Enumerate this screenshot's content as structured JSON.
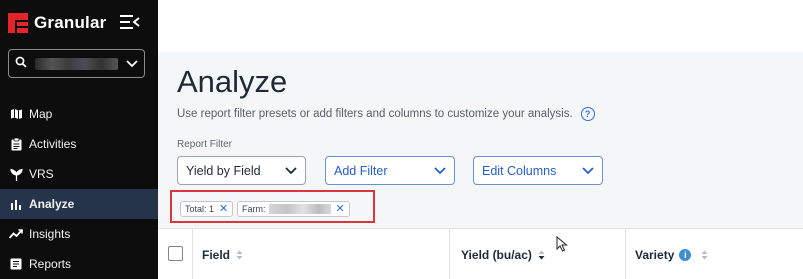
{
  "sidebar": {
    "brand": "Granular",
    "nav": [
      {
        "label": "Map",
        "icon": "map-icon"
      },
      {
        "label": "Activities",
        "icon": "clipboard-icon"
      },
      {
        "label": "VRS",
        "icon": "vrs-icon"
      },
      {
        "label": "Analyze",
        "icon": "bar-chart-icon",
        "active": true
      },
      {
        "label": "Insights",
        "icon": "trend-icon"
      },
      {
        "label": "Reports",
        "icon": "report-icon"
      }
    ]
  },
  "page": {
    "title": "Analyze",
    "subtitle": "Use report filter presets or add filters and columns to customize your analysis.",
    "help": "?"
  },
  "filters": {
    "label": "Report Filter",
    "report_filter_value": "Yield by Field",
    "add_filter_label": "Add Filter",
    "edit_columns_label": "Edit Columns"
  },
  "chips": {
    "total_label": "Total: 1",
    "farm_label": "Farm:",
    "remove_glyph": "✕"
  },
  "table": {
    "columns": [
      "Field",
      "Yield (bu/ac)",
      "Variety"
    ],
    "info": "i"
  },
  "colors": {
    "sidebar_bg": "#0d0d0d",
    "active_nav_bg": "#25344a",
    "brand_red": "#e4232b",
    "accent_blue": "#2660c9",
    "highlight_red": "#d9363e"
  }
}
